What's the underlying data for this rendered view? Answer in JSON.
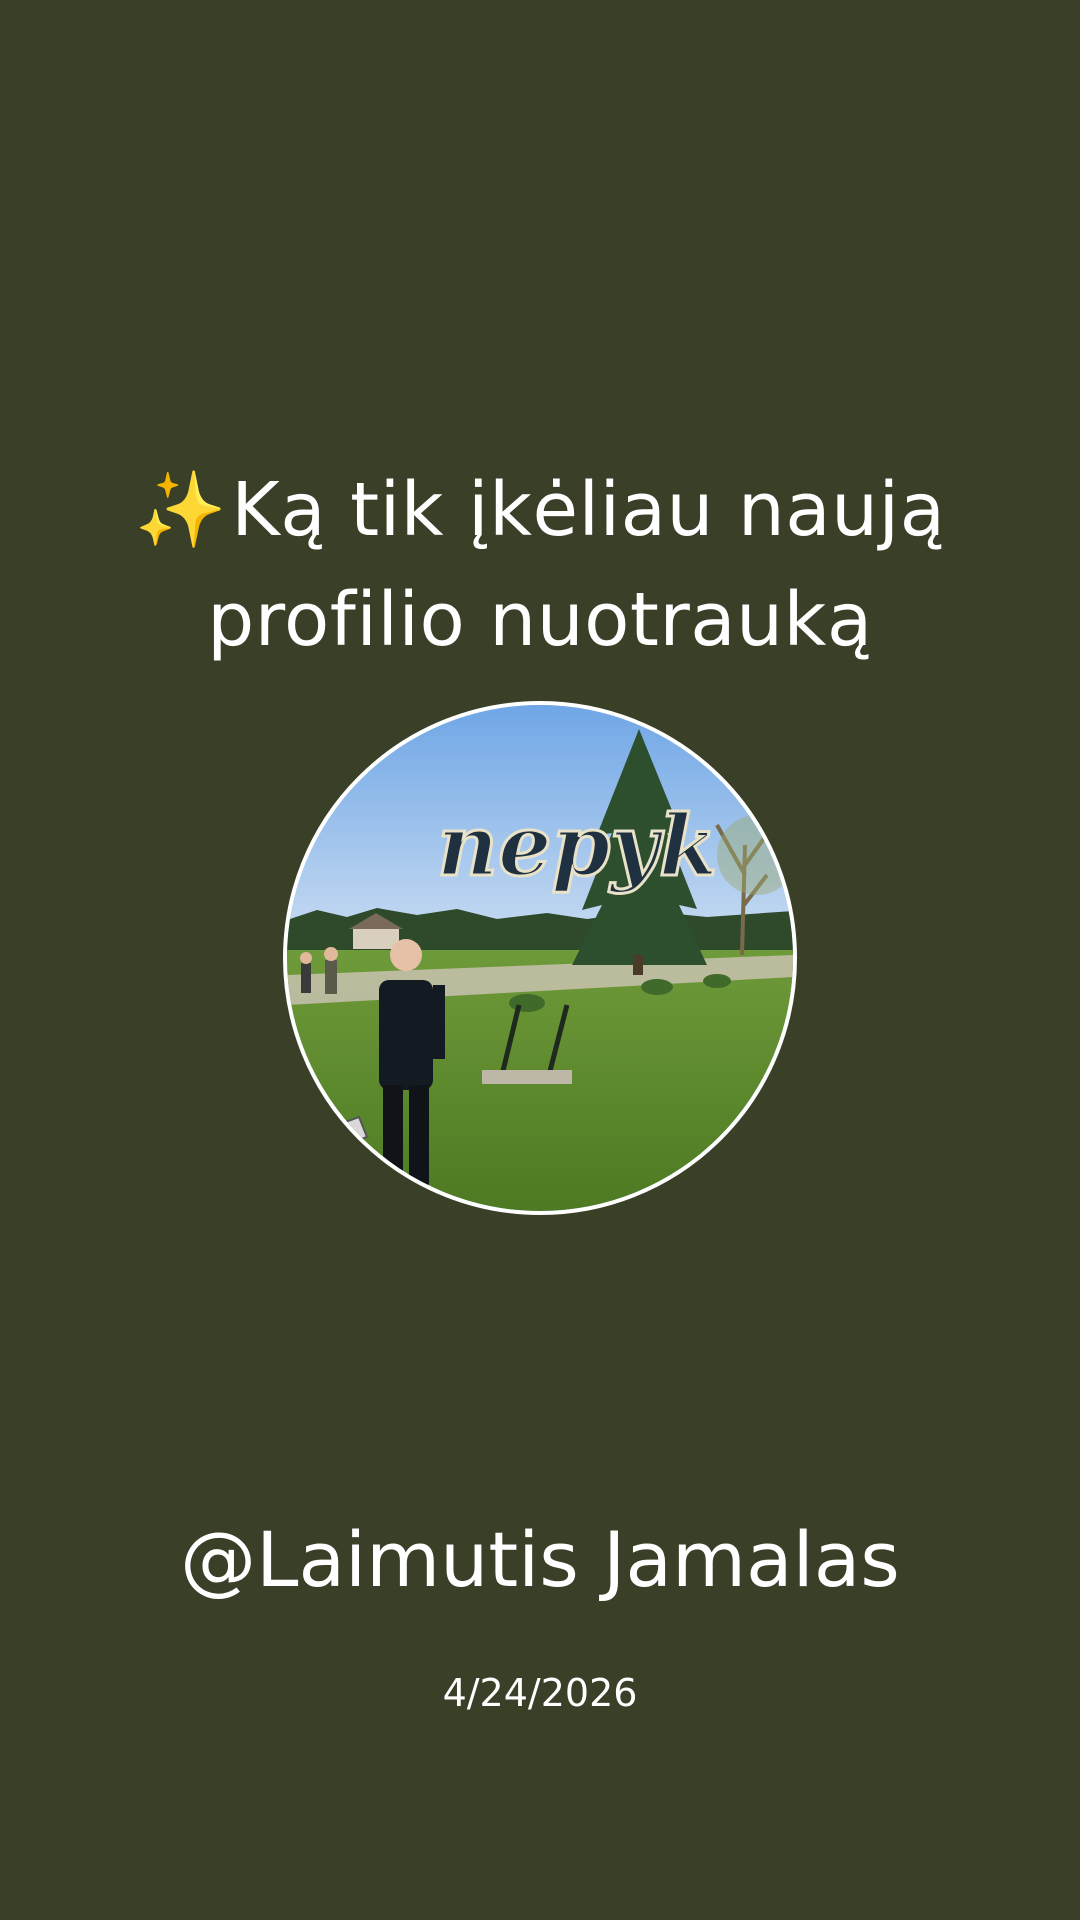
{
  "post": {
    "sparkle_icon": "sparkles-icon",
    "headline_line1": "Ką tik įkėliau naują",
    "headline_line2": "profilio nuotrauką",
    "username": "@Laimutis Jamalas",
    "date": "4/24/2026"
  },
  "photo": {
    "sign_text": "nepyk"
  },
  "colors": {
    "background": "#3a4028",
    "text": "#ffffff",
    "avatar_border": "#ffffff"
  }
}
